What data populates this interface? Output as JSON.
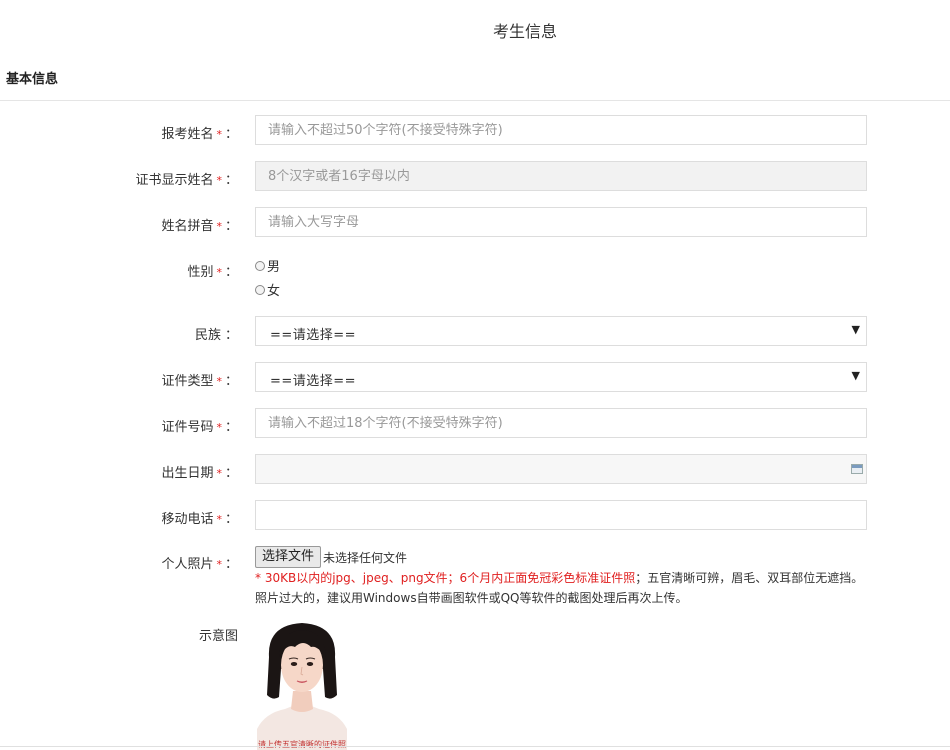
{
  "page": {
    "title": "考生信息"
  },
  "section": {
    "title": "基本信息"
  },
  "form": {
    "name": {
      "label": "报考姓名",
      "placeholder": "请输入不超过50个字符(不接受特殊字符)"
    },
    "cert_name": {
      "label": "证书显示姓名",
      "placeholder": "8个汉字或者16字母以内"
    },
    "pinyin": {
      "label": "姓名拼音",
      "placeholder": "请输入大写字母"
    },
    "gender": {
      "label": "性别",
      "options": [
        "男",
        "女"
      ]
    },
    "ethnicity": {
      "label": "民族",
      "value": "==请选择=="
    },
    "id_type": {
      "label": "证件类型",
      "value": "==请选择=="
    },
    "id_number": {
      "label": "证件号码",
      "placeholder": "请输入不超过18个字符(不接受特殊字符)"
    },
    "birth_date": {
      "label": "出生日期",
      "value": ""
    },
    "mobile": {
      "label": "移动电话",
      "value": ""
    },
    "photo": {
      "label": "个人照片",
      "button": "选择文件",
      "status": "未选择任何文件",
      "hint_prefix": "30KB以内的jpg、jpeg、png文件；6个月内正面免冠彩色标准",
      "hint_link": "证件照",
      "hint_suffix": "；五官清晰可辨，眉毛、双耳部位无遮挡。",
      "hint_line2": "照片过大的，建议用Windows自带画图软件或QQ等软件的截图处理后再次上传。"
    },
    "sample": {
      "label": "示意图",
      "caption": "请上传五官清晰的证件照"
    },
    "required_mark": "*",
    "colon": "："
  }
}
